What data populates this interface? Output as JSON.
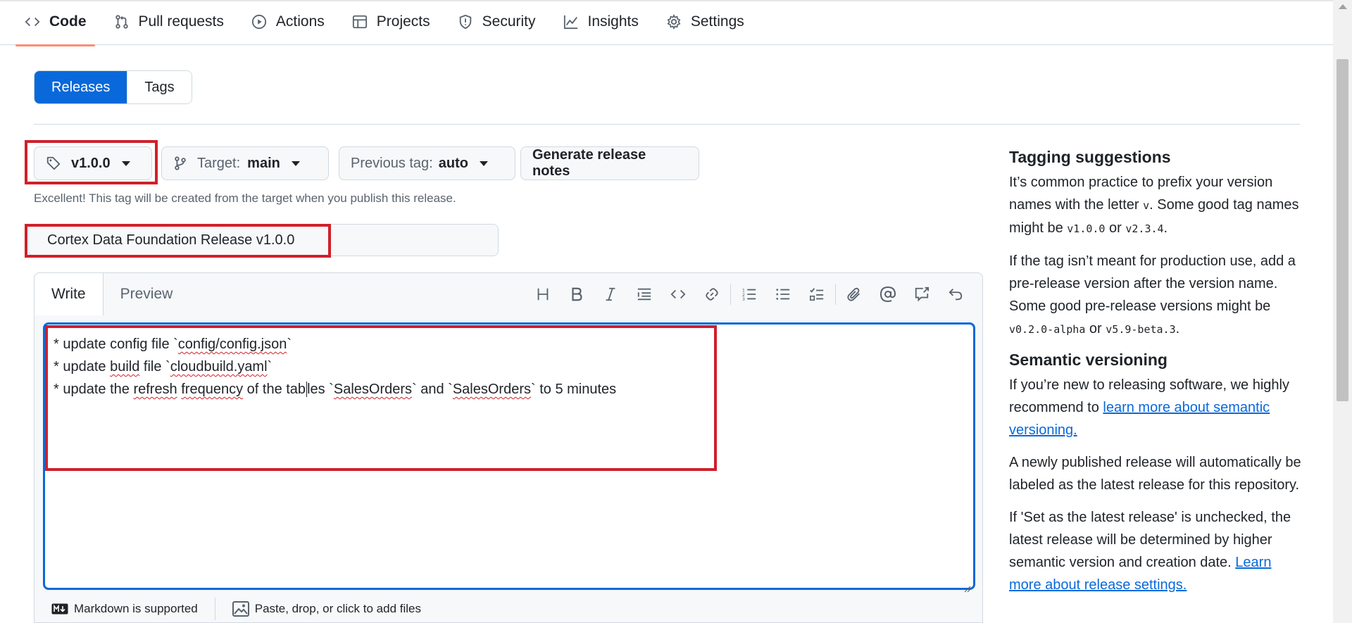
{
  "nav": {
    "tabs": [
      {
        "label": "Code",
        "icon": "code-icon"
      },
      {
        "label": "Pull requests",
        "icon": "pull-request-icon"
      },
      {
        "label": "Actions",
        "icon": "play-icon"
      },
      {
        "label": "Projects",
        "icon": "table-icon"
      },
      {
        "label": "Security",
        "icon": "shield-icon"
      },
      {
        "label": "Insights",
        "icon": "graph-icon"
      },
      {
        "label": "Settings",
        "icon": "gear-icon"
      }
    ],
    "active": "Code"
  },
  "switch": {
    "releases": "Releases",
    "tags": "Tags"
  },
  "controls": {
    "tag_value": "v1.0.0",
    "target_label": "Target:",
    "target_value": "main",
    "prev_tag_label": "Previous tag:",
    "prev_tag_value": "auto",
    "generate_label": "Generate release notes"
  },
  "hint": "Excellent! This tag will be created from the target when you publish this release.",
  "release_title": "Cortex Data Foundation Release v1.0.0",
  "editor": {
    "tab_write": "Write",
    "tab_preview": "Preview",
    "lines": [
      "* update config file `config/config.json`",
      "* update build file `cloudbuild.yaml`",
      "* update the refresh frequency of the tables `SalesOrders` and `SalesOrders` to 5 minutes"
    ],
    "footer_markdown": "Markdown is supported",
    "footer_files": "Paste, drop, or click to add files"
  },
  "sidebar": {
    "h1": "Tagging suggestions",
    "p1_a": "It’s common practice to prefix your version names with the letter ",
    "p1_code1": "v",
    "p1_b": ". Some good tag names might be ",
    "p1_code2": "v1.0.0",
    "p1_c": " or ",
    "p1_code3": "v2.3.4",
    "p1_d": ".",
    "p2_a": "If the tag isn’t meant for production use, add a pre-release version after the version name. Some good pre-release versions might be ",
    "p2_code1": "v0.2.0-alpha",
    "p2_b": " or ",
    "p2_code2": "v5.9-beta.3",
    "p2_c": ".",
    "h2": "Semantic versioning",
    "p3_a": "If you’re new to releasing software, we highly recommend to ",
    "p3_link": "learn more about semantic versioning.",
    "p4": "A newly published release will automatically be labeled as the latest release for this repository.",
    "p5_a": "If 'Set as the latest release' is unchecked, the latest release will be determined by higher semantic version and creation date. ",
    "p5_link": "Learn more about release settings."
  },
  "colors": {
    "accent": "#0969da",
    "highlight_box": "#d0202a",
    "tab_underline": "#fd8c73"
  }
}
